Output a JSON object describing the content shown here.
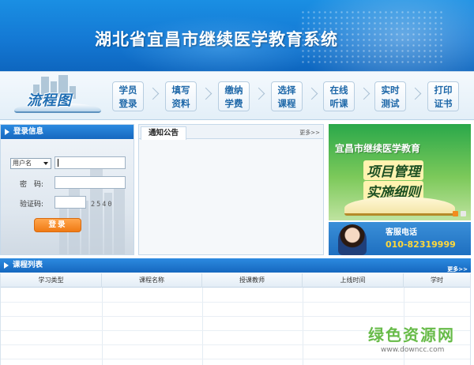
{
  "header": {
    "title": "湖北省宜昌市继续医学教育系统"
  },
  "flow": {
    "label": "流程图",
    "steps": [
      {
        "label": "学员\n登录"
      },
      {
        "label": "填写\n资料"
      },
      {
        "label": "缴纳\n学费"
      },
      {
        "label": "选择\n课程"
      },
      {
        "label": "在线\n听课"
      },
      {
        "label": "实时\n测试"
      },
      {
        "label": "打印\n证书"
      }
    ]
  },
  "login": {
    "title": "登录信息",
    "account_type": "用户名",
    "password_label": "密　码:",
    "captcha_label": "验证码:",
    "captcha_value": "2540",
    "submit_label": "登录"
  },
  "notice": {
    "tab_label": "通知公告",
    "more_label": "更多>>"
  },
  "ad": {
    "heading": "宜昌市继续医学教育",
    "line1": "项目管理",
    "line2": "实施细则",
    "hotline_label": "客服电话",
    "hotline_number": "010-82319999",
    "colors": {
      "active_dot": "#f28c1e",
      "inactive_dot": "#e8e8e8"
    }
  },
  "courses": {
    "title": "课程列表",
    "more_label": "更多>>",
    "columns": [
      "学习类型",
      "课程名称",
      "授课教师",
      "上线时间",
      "学时"
    ],
    "rows": []
  },
  "watermark": {
    "cn": "绿色资源网",
    "en": "www.downcc.com"
  },
  "theme": {
    "primary": "#1668bf",
    "accent": "#f07a14"
  }
}
